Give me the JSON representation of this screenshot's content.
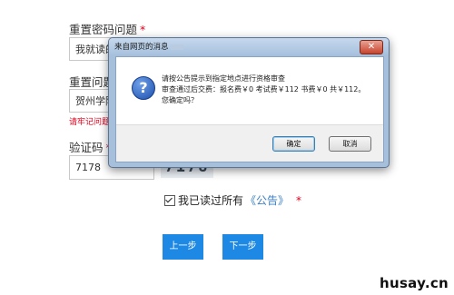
{
  "form": {
    "reset_question_label": "重置密码问题",
    "reset_question_required": "*",
    "reset_question_value": "我就读的",
    "reset_answer_label": "重置问题",
    "reset_answer_value": "贺州学院",
    "reset_answer_hint": "请牢记问题",
    "captcha_label": "验证码",
    "captcha_required": "*",
    "captcha_value": "7178",
    "captcha_image_text": "7178",
    "agree_text": "我已读过所有",
    "agree_link": "《公告》",
    "agree_required": "*",
    "prev_button": "上一步",
    "next_button": "下一步"
  },
  "dialog": {
    "title": "来自网页的消息",
    "close_symbol": "✕",
    "icon_symbol": "?",
    "message_line1": "请按公告提示到指定地点进行资格审查",
    "message_line2": "审查通过后交费：报名费￥0 考试费￥112 书费￥0 共￥112。",
    "message_line3": "您确定吗？",
    "ok_button": "确定",
    "cancel_button": "取消"
  },
  "watermark": "husay.cn",
  "colors": {
    "primary_button": "#1e88e5",
    "required": "#d9001b",
    "link": "#3b7fc4"
  }
}
